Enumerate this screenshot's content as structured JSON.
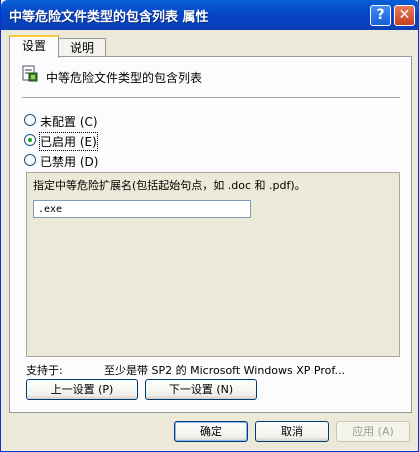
{
  "window": {
    "title": "中等危险文件类型的包含列表 属性",
    "help_glyph": "?",
    "close_glyph": "✕"
  },
  "tabs": [
    {
      "label": "设置"
    },
    {
      "label": "说明"
    }
  ],
  "policy": {
    "title": "中等危险文件类型的包含列表"
  },
  "radios": [
    {
      "label": "未配置 (C)",
      "checked": false
    },
    {
      "label": "已启用 (E)",
      "checked": true
    },
    {
      "label": "已禁用 (D)",
      "checked": false
    }
  ],
  "options": {
    "description": "指定中等危险扩展名(包括起始句点，如 .doc 和 .pdf)。",
    "value": ".exe"
  },
  "supported": {
    "label": "支持于:",
    "value": "至少是带 SP2 的 Microsoft Windows XP Prof..."
  },
  "nav": {
    "prev": "上一设置 (P)",
    "next": "下一设置 (N)"
  },
  "footer": {
    "ok": "确定",
    "cancel": "取消",
    "apply": "应用 (A)"
  },
  "colors": {
    "titlebar": "#0545c5",
    "face": "#ece9d8",
    "radio_check": "#21a121",
    "tab_highlight": "#ffc83d"
  }
}
